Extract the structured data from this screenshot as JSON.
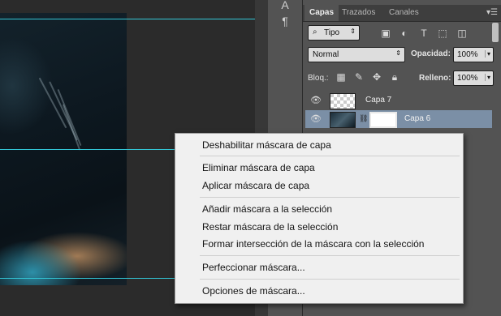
{
  "tabs": [
    "Capas",
    "Trazados",
    "Canales"
  ],
  "filter": {
    "label": "Tipo"
  },
  "blend": {
    "value": "Normal",
    "opacity_label": "Opacidad:",
    "opacity_value": "100%"
  },
  "lock": {
    "label": "Bloq.:",
    "fill_label": "Relleno:",
    "fill_value": "100%"
  },
  "layers": [
    {
      "name": "Capa 7"
    },
    {
      "name": "Capa 6"
    }
  ],
  "context_menu": [
    "Deshabilitar máscara de capa",
    "Eliminar máscara de capa",
    "Aplicar máscara de capa",
    "Añadir máscara a la selección",
    "Restar máscara de la selección",
    "Formar intersección de la máscara con la selección",
    "Perfeccionar máscara...",
    "Opciones de máscara..."
  ],
  "colors": {
    "guide": "#33c6d6",
    "selected_layer": "#7b8fa6",
    "panel_bg": "#535353"
  }
}
